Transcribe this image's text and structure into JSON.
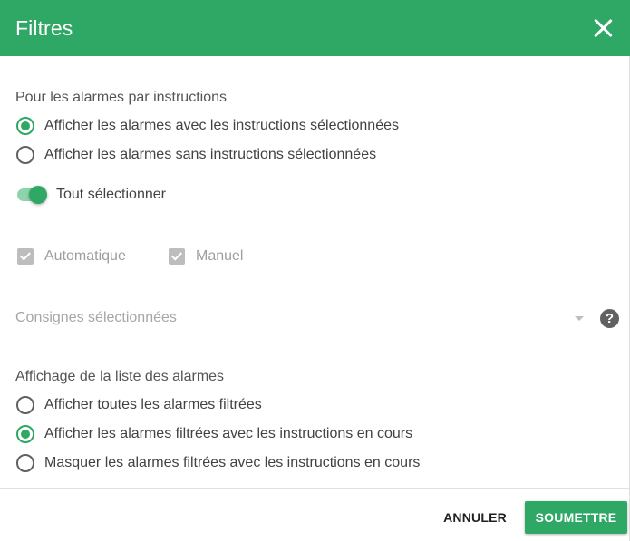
{
  "dialog": {
    "title": "Filtres",
    "close_icon": "close-icon"
  },
  "instructions": {
    "label": "Pour les alarmes par instructions",
    "options": [
      {
        "label": "Afficher les alarmes avec les instructions sélectionnées",
        "checked": true
      },
      {
        "label": "Afficher les alarmes sans instructions sélectionnées",
        "checked": false
      }
    ],
    "select_all": {
      "label": "Tout sélectionner",
      "on": true
    },
    "checkboxes": [
      {
        "label": "Automatique",
        "checked": true,
        "disabled": true
      },
      {
        "label": "Manuel",
        "checked": true,
        "disabled": true
      }
    ],
    "select": {
      "placeholder": "Consignes sélectionnées"
    },
    "help_icon": "help-icon"
  },
  "display": {
    "label": "Affichage de la liste des alarmes",
    "options": [
      {
        "label": "Afficher toutes les alarmes filtrées",
        "checked": false
      },
      {
        "label": "Afficher les alarmes filtrées avec les instructions en cours",
        "checked": true
      },
      {
        "label": "Masquer les alarmes filtrées avec les instructions en cours",
        "checked": false
      }
    ]
  },
  "footer": {
    "cancel_label": "ANNULER",
    "submit_label": "SOUMETTRE"
  },
  "colors": {
    "accent": "#2fa865",
    "switch_track": "#8fd3ad"
  }
}
